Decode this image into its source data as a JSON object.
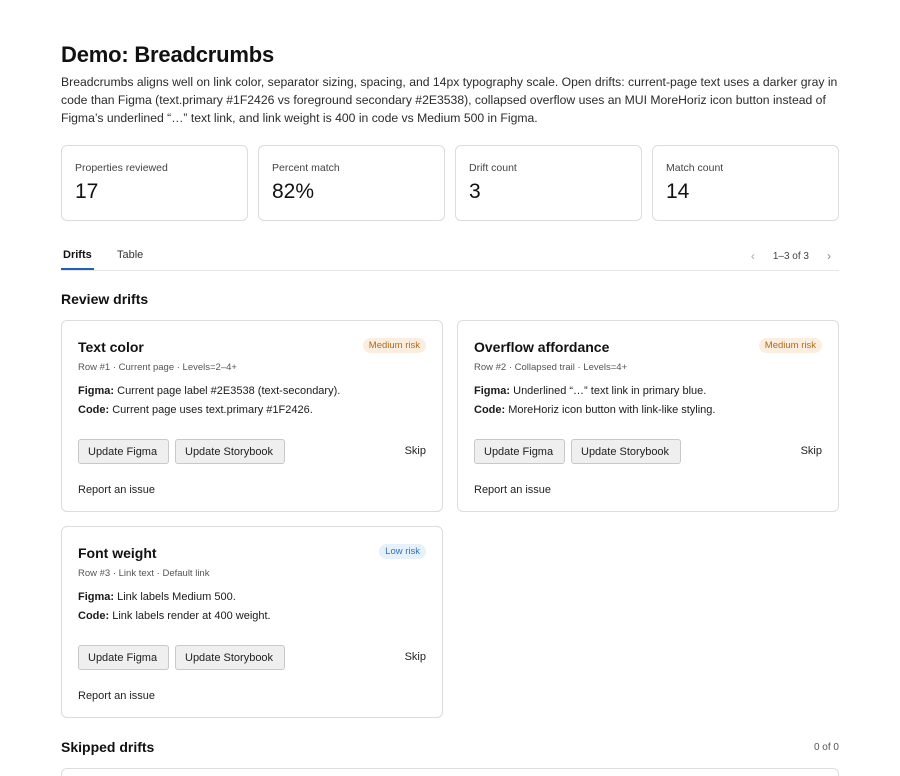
{
  "header": {
    "title": "Demo: Breadcrumbs",
    "description": "Breadcrumbs aligns well on link color, separator sizing, spacing, and 14px typography scale. Open drifts: current-page text uses a darker gray in code than Figma (text.primary #1F2426 vs foreground secondary #2E3538), collapsed overflow uses an MUI MoreHoriz icon button instead of Figma’s underlined “…” text link, and link weight is 400 in code vs Medium 500 in Figma."
  },
  "metrics": [
    {
      "label": "Properties reviewed",
      "value": "17"
    },
    {
      "label": "Percent match",
      "value": "82%"
    },
    {
      "label": "Drift count",
      "value": "3"
    },
    {
      "label": "Match count",
      "value": "14"
    }
  ],
  "tabs": {
    "drifts": "Drifts",
    "table": "Table",
    "pager": "1–3 of 3",
    "prev": "‹",
    "next": "›"
  },
  "review": {
    "title": "Review drifts"
  },
  "cards": [
    {
      "title": "Text color",
      "risk": "Medium risk",
      "meta": "Row #1 · Current page · Levels=2–4+",
      "figma_label": "Figma:",
      "figma_text": "Current page label #2E3538 (text-secondary).",
      "code_label": "Code:",
      "code_text": "Current page uses text.primary #1F2426."
    },
    {
      "title": "Overflow affordance",
      "risk": "Medium risk",
      "meta": "Row #2 · Collapsed trail · Levels=4+",
      "figma_label": "Figma:",
      "figma_text": "Underlined “…” text link in primary blue.",
      "code_label": "Code:",
      "code_text": "MoreHoriz icon button with link-like styling."
    },
    {
      "title": "Font weight",
      "risk": "Low risk",
      "meta": "Row #3 · Link text · Default link",
      "figma_label": "Figma:",
      "figma_text": "Link labels Medium 500.",
      "code_label": "Code:",
      "code_text": "Link labels render at 400 weight."
    }
  ],
  "actions": {
    "update_figma": "Update Figma",
    "update_storybook": "Update Storybook",
    "skip": "Skip",
    "report": "Report an issue"
  },
  "skipped": {
    "title": "Skipped drifts",
    "count": "0 of 0"
  },
  "colors": {
    "accent": "#1f5fbf",
    "medium_risk_bg": "#fbeede",
    "medium_risk_text": "#b06a1c",
    "low_risk_bg": "#e6f1fb",
    "low_risk_text": "#2f73b8"
  }
}
